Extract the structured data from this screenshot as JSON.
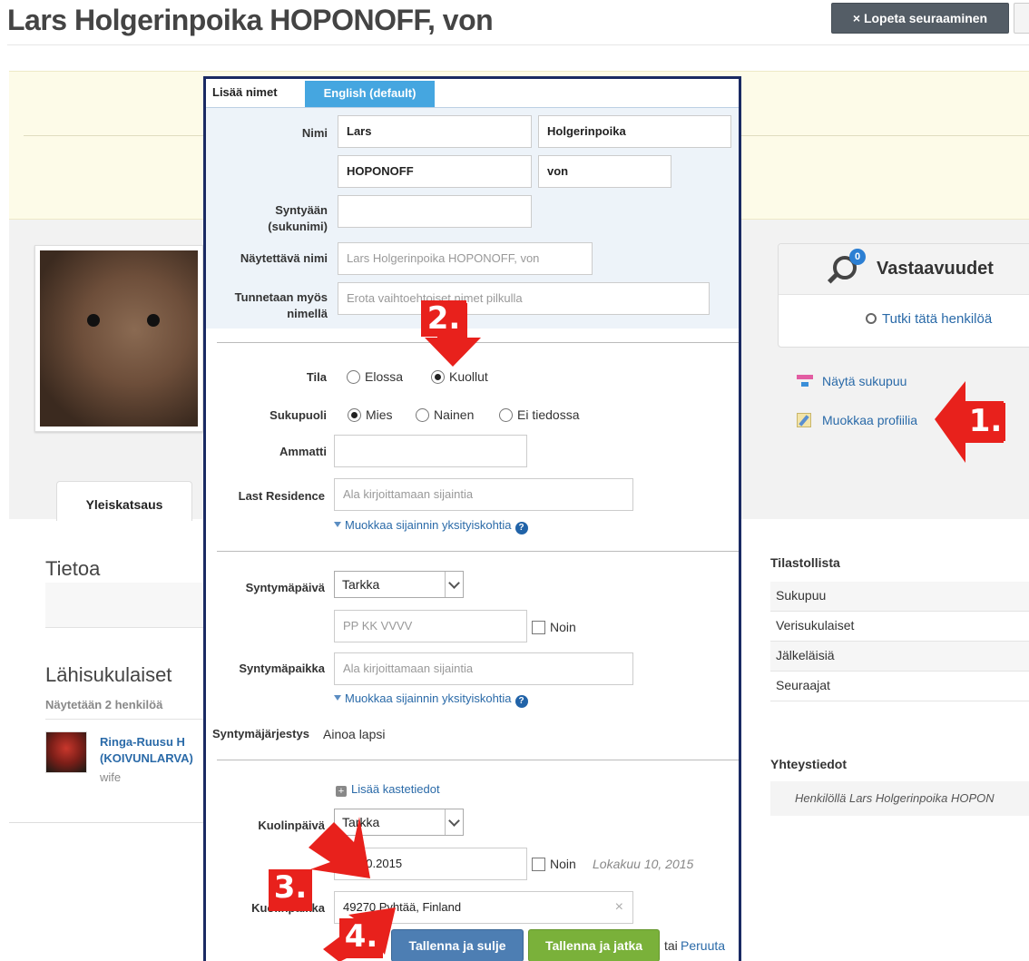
{
  "page": {
    "title": "Lars Holgerinpoika HOPONOFF, von",
    "unfollow_label": "× Lopeta seuraaminen"
  },
  "profile": {
    "tab_overview": "Yleiskatsaus",
    "about_heading": "Tietoa",
    "relatives_heading": "Lähisukulaiset",
    "relatives_showing": "Näytetään 2 henkilöä",
    "relative_name_line1": "Ringa-Ruusu H",
    "relative_name_line2": "(KOIVUNLARVA)",
    "relative_role": "wife"
  },
  "matches": {
    "badge": "0",
    "title": "Vastaavuudet",
    "research_label": "Tutki tätä henkilöä"
  },
  "actions": {
    "show_tree": "Näytä sukupuu",
    "edit_profile": "Muokkaa profiilia"
  },
  "stats": {
    "heading": "Tilastollista",
    "rows": [
      "Sukupuu",
      "Verisukulaiset",
      "Jälkeläisiä",
      "Seuraajat"
    ]
  },
  "contact": {
    "heading": "Yhteystiedot",
    "text": "Henkilöllä Lars Holgerinpoika HOPON"
  },
  "editor": {
    "tab_add_names": "Lisää nimet",
    "tab_language": "English (default)",
    "name_label": "Nimi",
    "first_name": "Lars",
    "middle_name": "Holgerinpoika",
    "last_name": "HOPONOFF",
    "suffix": "von",
    "birth_surname_label_1": "Syntyään",
    "birth_surname_label_2": "(sukunimi)",
    "birth_surname_value": "",
    "display_name_label": "Näytettävä nimi",
    "display_name_placeholder": "Lars Holgerinpoika HOPONOFF, von",
    "aka_label_1": "Tunnetaan myös",
    "aka_label_2": "nimellä",
    "aka_placeholder": "Erota vaihtoehtoiset nimet pilkulla",
    "status_label": "Tila",
    "status_alive": "Elossa",
    "status_deceased": "Kuollut",
    "gender_label": "Sukupuoli",
    "gender_male": "Mies",
    "gender_female": "Nainen",
    "gender_unknown": "Ei tiedossa",
    "occupation_label": "Ammatti",
    "occupation_value": "",
    "residence_label": "Last Residence",
    "residence_placeholder": "Ala kirjoittamaan sijaintia",
    "edit_location_details": "Muokkaa sijainnin yksityiskohtia",
    "birth_date_label": "Syntymäpäivä",
    "birth_date_precision": "Tarkka",
    "birth_date_placeholder": "PP KK VVVV",
    "approx_label": "Noin",
    "birth_place_label": "Syntymäpaikka",
    "birth_place_placeholder": "Ala kirjoittamaan sijaintia",
    "birth_order_label": "Syntymäjärjestys",
    "birth_order_value": "Ainoa lapsi",
    "add_baptism": "Lisää kastetiedot",
    "death_date_label": "Kuolinpäivä",
    "death_date_precision": "Tarkka",
    "death_date_value": "10.10.2015",
    "death_date_display": "Lokakuu 10, 2015",
    "death_place_label": "Kuolinpaikka",
    "death_place_value": "49270 Pyhtää, Finland",
    "save_close": "Tallenna ja sulje",
    "save_continue": "Tallenna ja jatka",
    "or_text": "tai",
    "cancel": "Peruuta"
  },
  "annotations": {
    "step1": "1.",
    "step2": "2.",
    "step3": "3.",
    "step4": "4.",
    "color": "#e8211c"
  }
}
